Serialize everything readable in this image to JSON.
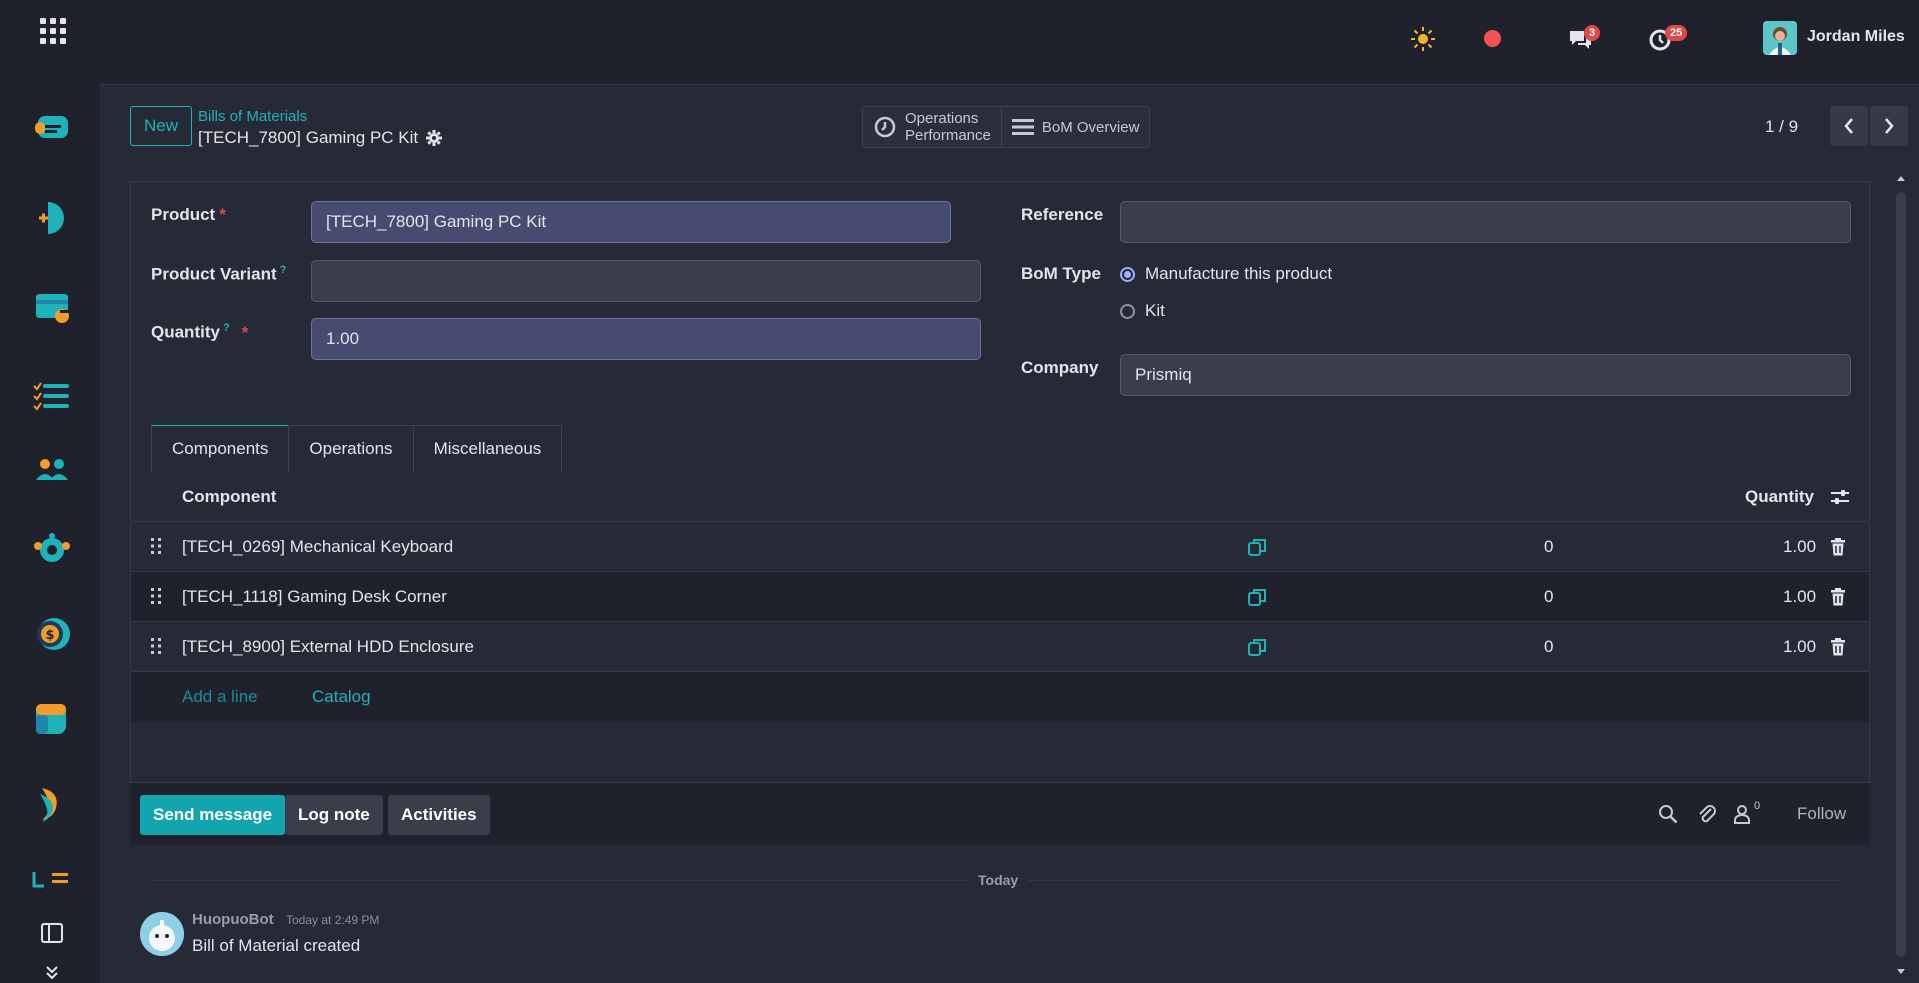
{
  "topbar": {
    "username": "Jordan Miles",
    "messages_count": "3",
    "activities_count": "25"
  },
  "control": {
    "new_label": "New",
    "breadcrumb": "Bills of Materials",
    "record_title": "[TECH_7800] Gaming PC Kit",
    "ops_perf_line1": "Operations",
    "ops_perf_line2": "Performance",
    "bom_overview": "BoM Overview",
    "pager": "1 / 9"
  },
  "form": {
    "product_label": "Product",
    "product_value": "[TECH_7800] Gaming PC Kit",
    "variant_label": "Product Variant",
    "variant_value": "",
    "quantity_label": "Quantity",
    "quantity_value": "1.00",
    "reference_label": "Reference",
    "reference_value": "",
    "bom_type_label": "BoM Type",
    "bom_type_options": [
      "Manufacture this product",
      "Kit"
    ],
    "company_label": "Company",
    "company_value": "Prismiq",
    "help_mark": "?",
    "required_mark": "*"
  },
  "tabs": [
    "Components",
    "Operations",
    "Miscellaneous"
  ],
  "table": {
    "col_component": "Component",
    "col_quantity": "Quantity",
    "rows": [
      {
        "component": "[TECH_0269] Mechanical Keyboard",
        "mid": "0",
        "quantity": "1.00"
      },
      {
        "component": "[TECH_1118] Gaming Desk Corner",
        "mid": "0",
        "quantity": "1.00"
      },
      {
        "component": "[TECH_8900] External HDD Enclosure",
        "mid": "0",
        "quantity": "1.00"
      }
    ],
    "add_line": "Add a line",
    "catalog": "Catalog"
  },
  "chatter": {
    "send_message": "Send message",
    "log_note": "Log note",
    "activities": "Activities",
    "followers_count": "0",
    "follow": "Follow",
    "today": "Today",
    "author": "HuopuoBot",
    "timestamp": "Today at 2:49 PM",
    "body": "Bill of Material created"
  },
  "colors": {
    "accent": "#1eb3bb",
    "danger": "#e04848",
    "background": "#262a36",
    "navbar": "#1f222c"
  }
}
